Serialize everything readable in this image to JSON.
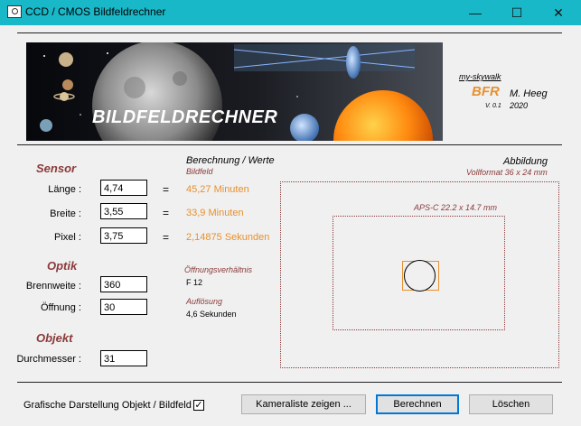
{
  "window": {
    "title": "CCD / CMOS  Bildfeldrechner",
    "minimize_glyph": "—",
    "maximize_glyph": "☐",
    "close_glyph": "✕"
  },
  "banner": {
    "title": "BILDFELDRECHNER"
  },
  "credit": {
    "site": "my-skywalk",
    "app": "BFR",
    "author": "M. Heeg",
    "version": "V. 0.1",
    "year": "2020"
  },
  "sensor": {
    "heading": "Sensor",
    "laenge_label": "Länge :",
    "laenge_value": "4,74",
    "breite_label": "Breite :",
    "breite_value": "3,55",
    "pixel_label": "Pixel :",
    "pixel_value": "3,75"
  },
  "optik": {
    "heading": "Optik",
    "brennweite_label": "Brennweite :",
    "brennweite_value": "360",
    "oeffnung_label": "Öffnung :",
    "oeffnung_value": "30"
  },
  "objekt": {
    "heading": "Objekt",
    "durchmesser_label": "Durchmesser :",
    "durchmesser_value": "31"
  },
  "results": {
    "heading": "Berechnung / Werte",
    "sub": "Bildfeld",
    "eq": "=",
    "laenge": "45,27 Minuten",
    "breite": "33,9 Minuten",
    "pixel": "2,14875  Sekunden",
    "oeffnungsverhaeltnis_label": "Öffnungsverhältnis",
    "oeffnungsverhaeltnis_value": "F 12",
    "aufloesung_label": "Auflösung",
    "aufloesung_value": "4,6 Sekunden"
  },
  "abbildung": {
    "heading": "Abbildung",
    "vollformat": "Vollformat 36 x 24 mm",
    "aps_c": "APS-C  22.2 x 14.7 mm"
  },
  "footer": {
    "checkbox_label": "Grafische Darstellung Objekt / Bildfeld",
    "checkbox_checked": true,
    "kameraliste": "Kameraliste zeigen ...",
    "berechnen": "Berechnen",
    "loeschen": "Löschen"
  }
}
